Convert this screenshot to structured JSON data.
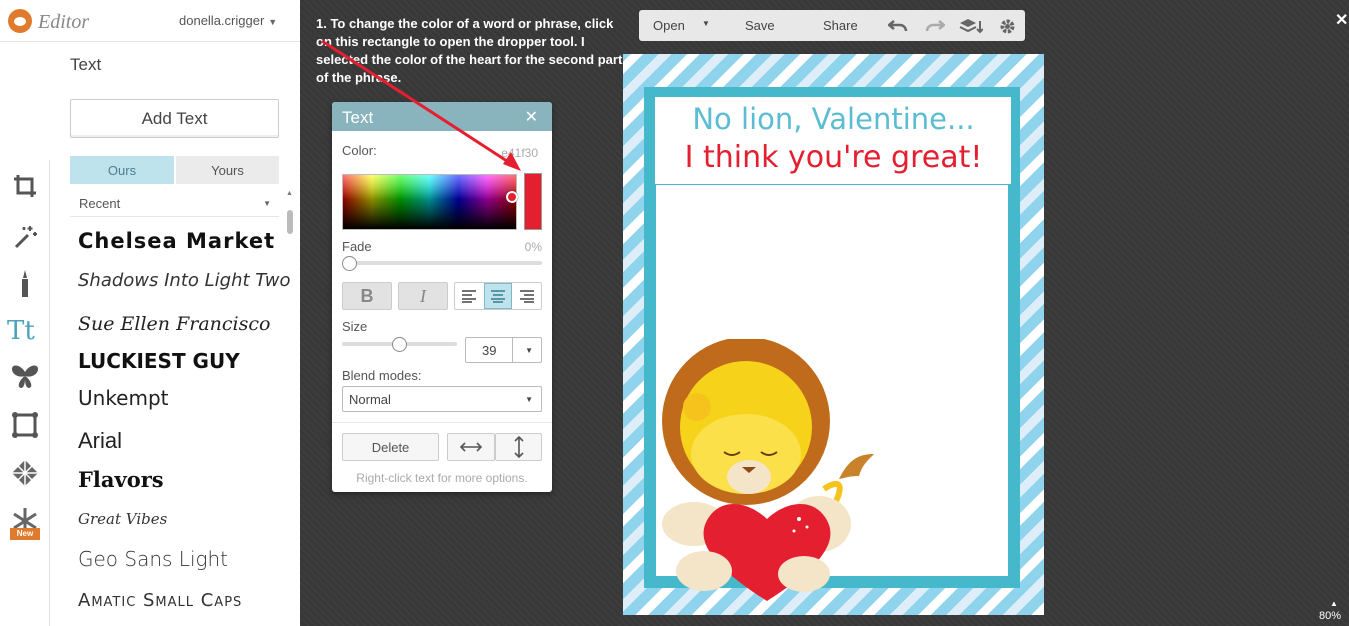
{
  "app": {
    "name": "Editor",
    "user": "donella.crigger"
  },
  "sidebar": {
    "panel_title": "Text",
    "add_text_label": "Add Text",
    "tabs": [
      "Ours",
      "Yours"
    ],
    "filter": "Recent",
    "fonts": [
      "Chelsea Market",
      "Shadows Into Light Two",
      "Sue Ellen Francisco",
      "Luckiest Guy",
      "Unkempt",
      "Arial",
      "Flavors",
      "Great Vibes",
      "Geo Sans Light",
      "Amatic Small Caps"
    ],
    "tools": [
      "crop-icon",
      "magic-wand-icon",
      "touch-up-icon",
      "text-icon",
      "overlays-icon",
      "frames-icon",
      "textures-icon",
      "seasonal-icon"
    ],
    "new_badge": "New"
  },
  "annotation": {
    "text": "1. To change the color of a word or phrase, click on this rectangle to open the dropper tool. I selected the color of the heart for the second part of the phrase.",
    "arrow_color": "#e41f30"
  },
  "text_dialog": {
    "title": "Text",
    "color_label": "Color:",
    "color_value": "e41f30",
    "selected_color": "#e41f30",
    "fade_label": "Fade",
    "fade_value": "0%",
    "size_label": "Size",
    "size_value": "39",
    "blend_label": "Blend modes:",
    "blend_value": "Normal",
    "bold": "B",
    "italic": "I",
    "alignment": "center",
    "delete_label": "Delete",
    "hint": "Right-click text for more options."
  },
  "toolbar": {
    "open": "Open",
    "save": "Save",
    "share": "Share"
  },
  "canvas": {
    "line1": "No lion, Valentine...",
    "line2": "I think you're great!",
    "zoom": "80%"
  }
}
